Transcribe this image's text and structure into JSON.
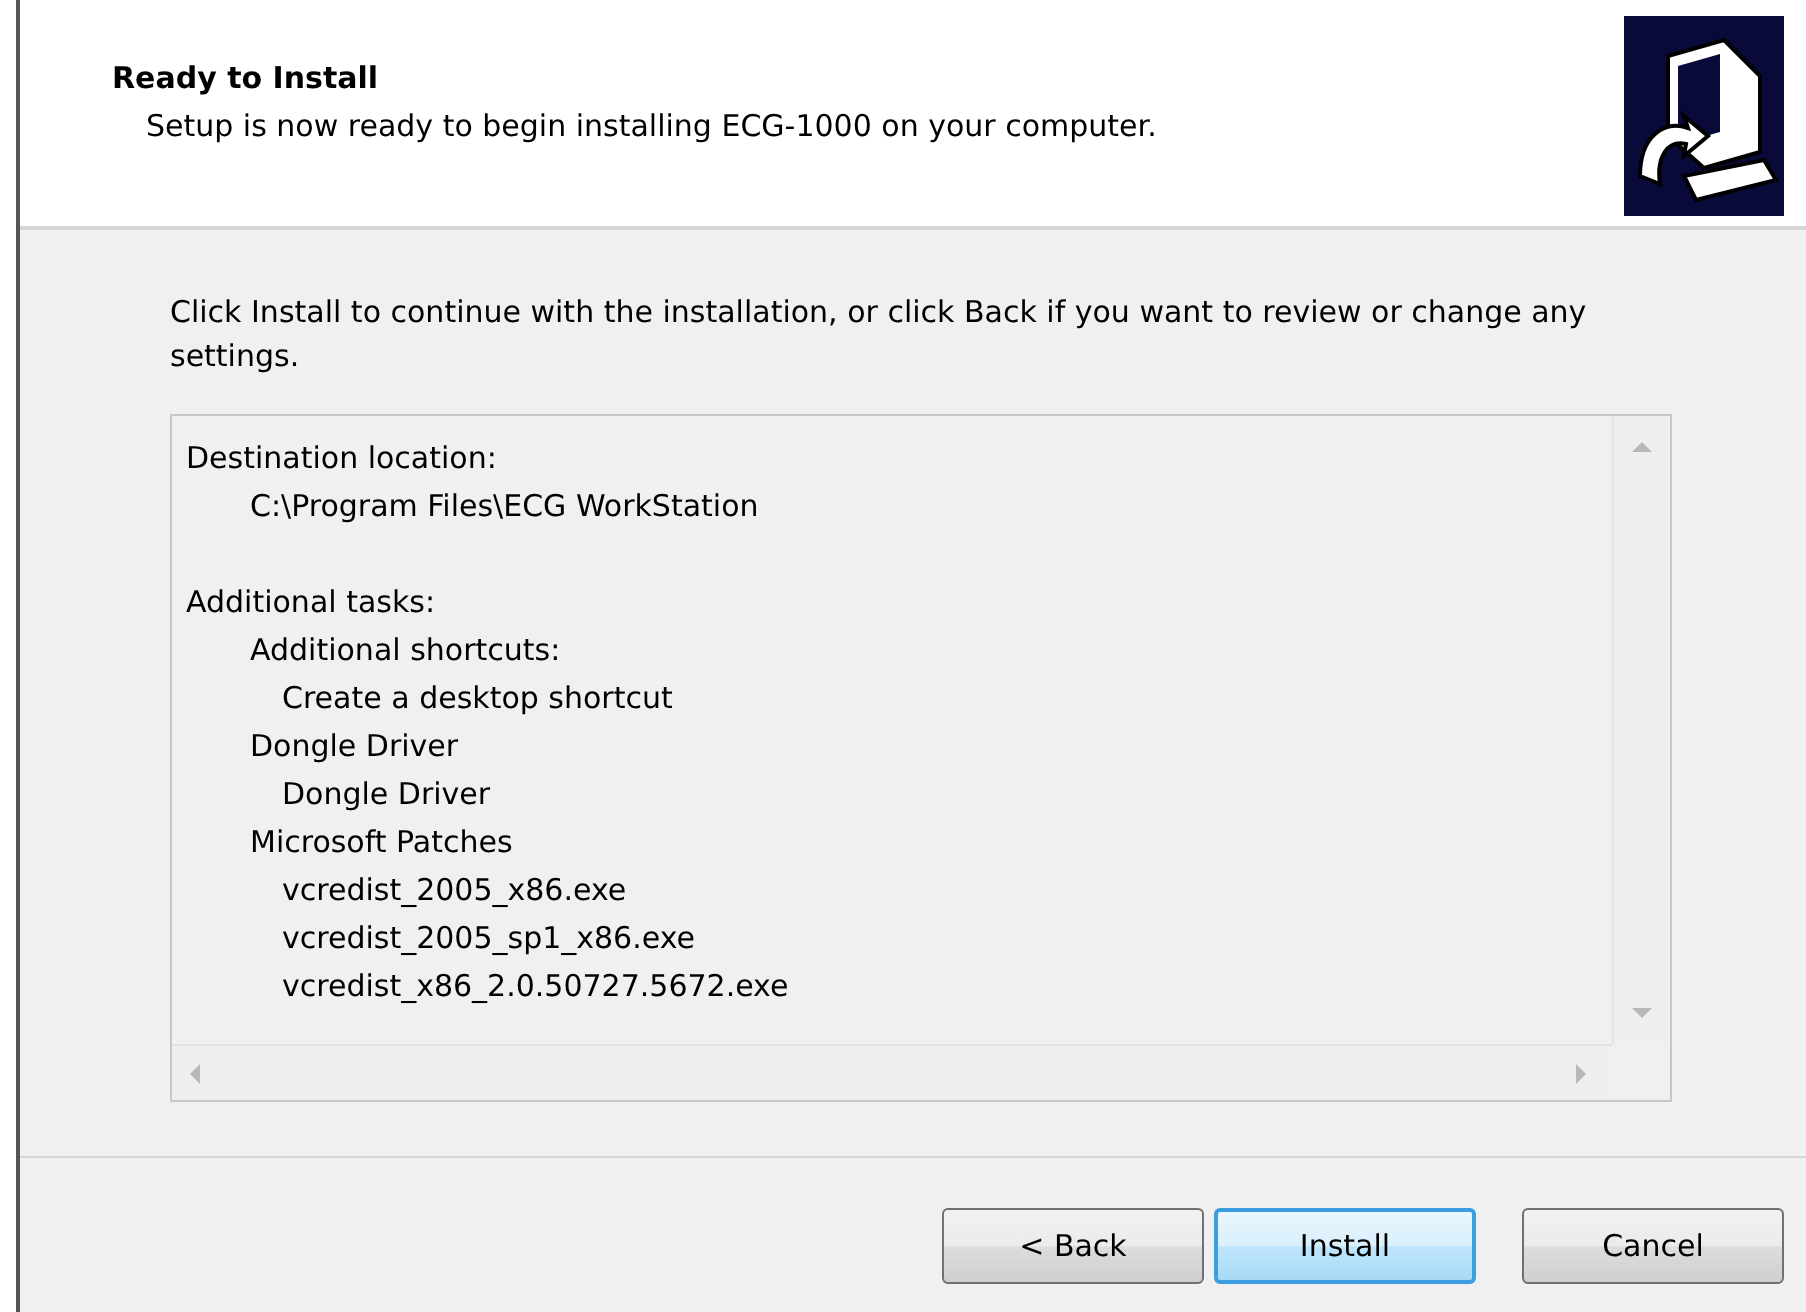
{
  "header": {
    "title": "Ready to Install",
    "subtitle": "Setup is now ready to begin installing ECG-1000 on your computer."
  },
  "instruction": "Click Install to continue with the installation, or click Back if you want to review or change any settings.",
  "summary": [
    {
      "text": "Destination location:",
      "children": [
        {
          "text": "C:\\Program Files\\ECG WorkStation"
        }
      ]
    },
    {
      "text": "Additional tasks:",
      "children": [
        {
          "text": "Additional shortcuts:",
          "children": [
            {
              "text": "Create a desktop shortcut"
            }
          ]
        },
        {
          "text": "Dongle Driver",
          "children": [
            {
              "text": "Dongle Driver"
            }
          ]
        },
        {
          "text": "Microsoft Patches",
          "children": [
            {
              "text": "vcredist_2005_x86.exe"
            },
            {
              "text": "vcredist_2005_sp1_x86.exe"
            },
            {
              "text": "vcredist_x86_2.0.50727.5672.exe"
            }
          ]
        }
      ]
    }
  ],
  "buttons": [
    {
      "label": "< Back",
      "default": false
    },
    {
      "label": "Install",
      "default": true
    },
    {
      "label": "Cancel",
      "default": false
    }
  ]
}
